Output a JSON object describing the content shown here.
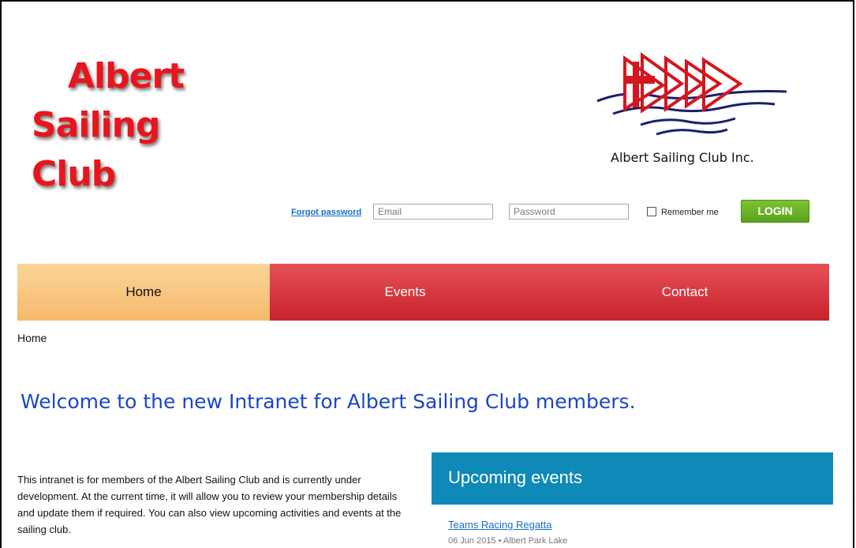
{
  "header": {
    "site_title_line1": "Albert",
    "site_title_line2": "Sailing Club",
    "logo_caption": "Albert Sailing Club Inc."
  },
  "login": {
    "forgot_password": "Forgot password",
    "email_placeholder": "Email",
    "password_placeholder": "Password",
    "remember_label": "Remember me",
    "login_button": "LOGIN"
  },
  "nav": {
    "items": [
      {
        "label": "Home"
      },
      {
        "label": "Events"
      },
      {
        "label": "Contact"
      }
    ]
  },
  "breadcrumb": "Home",
  "main": {
    "welcome": "Welcome to the new Intranet for Albert Sailing Club members.",
    "intro": "This intranet is for members of the Albert Sailing Club and is currently under development. At the current time, it will allow you to review your membership details and update them if required. You can also view upcoming activities and events at the sailing club."
  },
  "events": {
    "title": "Upcoming events",
    "items": [
      {
        "name": "Teams Racing Regatta",
        "meta": "06 Jun 2015 • Albert Park Lake"
      }
    ]
  },
  "colors": {
    "title_red": "#e8151d",
    "nav_active": "#f6b96c",
    "nav_red": "#c8222b",
    "login_green": "#5aa21a",
    "welcome_blue": "#1a47c4",
    "events_panel": "#0e89b8"
  }
}
